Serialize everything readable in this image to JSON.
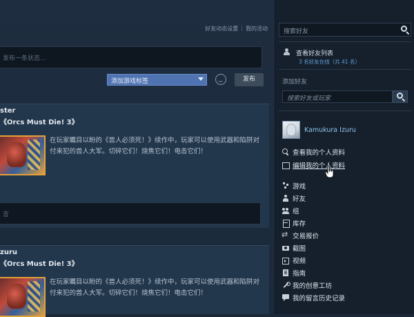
{
  "header": {
    "link_settings": "好友动态设置",
    "separator": "|",
    "link_my_activity": "我的活动"
  },
  "status": {
    "placeholder": "发布一条状态..."
  },
  "composer": {
    "tag_select": "添加游戏标签",
    "post_label": "发布"
  },
  "feed": [
    {
      "user": "ster",
      "game": "《Orcs Must Die! 3》",
      "description": "在玩家瞩目以盼的《兽人必须死！》续作中，玩家可以使用武器和陷阱对付来犯的兽人大军。切碎它们！烧焦它们！电击它们！",
      "comment_placeholder": "言"
    },
    {
      "user": "zuru",
      "game": "《Orcs Must Die! 3》",
      "description": "在玩家瞩目以盼的《兽人必须死！》续作中，玩家可以使用武器和陷阱对付来犯的兽人大军。切碎它们！烧焦它们！电击它们！"
    }
  ],
  "sidebar": {
    "friend_search_placeholder": "搜索好友",
    "view_friends": "查看好友列表",
    "friends_online": "3 名好友在线（共 41 名）",
    "add_friend_title": "添加好友",
    "friend_code_placeholder": "搜索好友或玩家",
    "profile_name": "Kamukura Izuru",
    "menu": {
      "view_profile": "查看我的个人资料",
      "edit_profile": "编辑我的个人资料",
      "games": "游戏",
      "friends": "好友",
      "groups": "组",
      "inventory": "库存",
      "trade_offers": "交易报价",
      "screenshots": "截图",
      "videos": "视频",
      "guides": "指南",
      "workshop": "我的创意工坊",
      "comment_history": "我的留言历史记录"
    }
  },
  "icons": {
    "search": "search-icon",
    "person": "person-icon",
    "emoticon": "smiley-icon",
    "dropdown": "chevron-down-icon",
    "cursor": "hand-pointer-icon"
  },
  "colors": {
    "background": "#1b2838",
    "sidebar": "#16202d",
    "accent_blue": "#4f73b0",
    "link_blue": "#5f9fd8",
    "profile_name": "#8fc3ea",
    "game_thumb_border": "#e5a23a"
  }
}
